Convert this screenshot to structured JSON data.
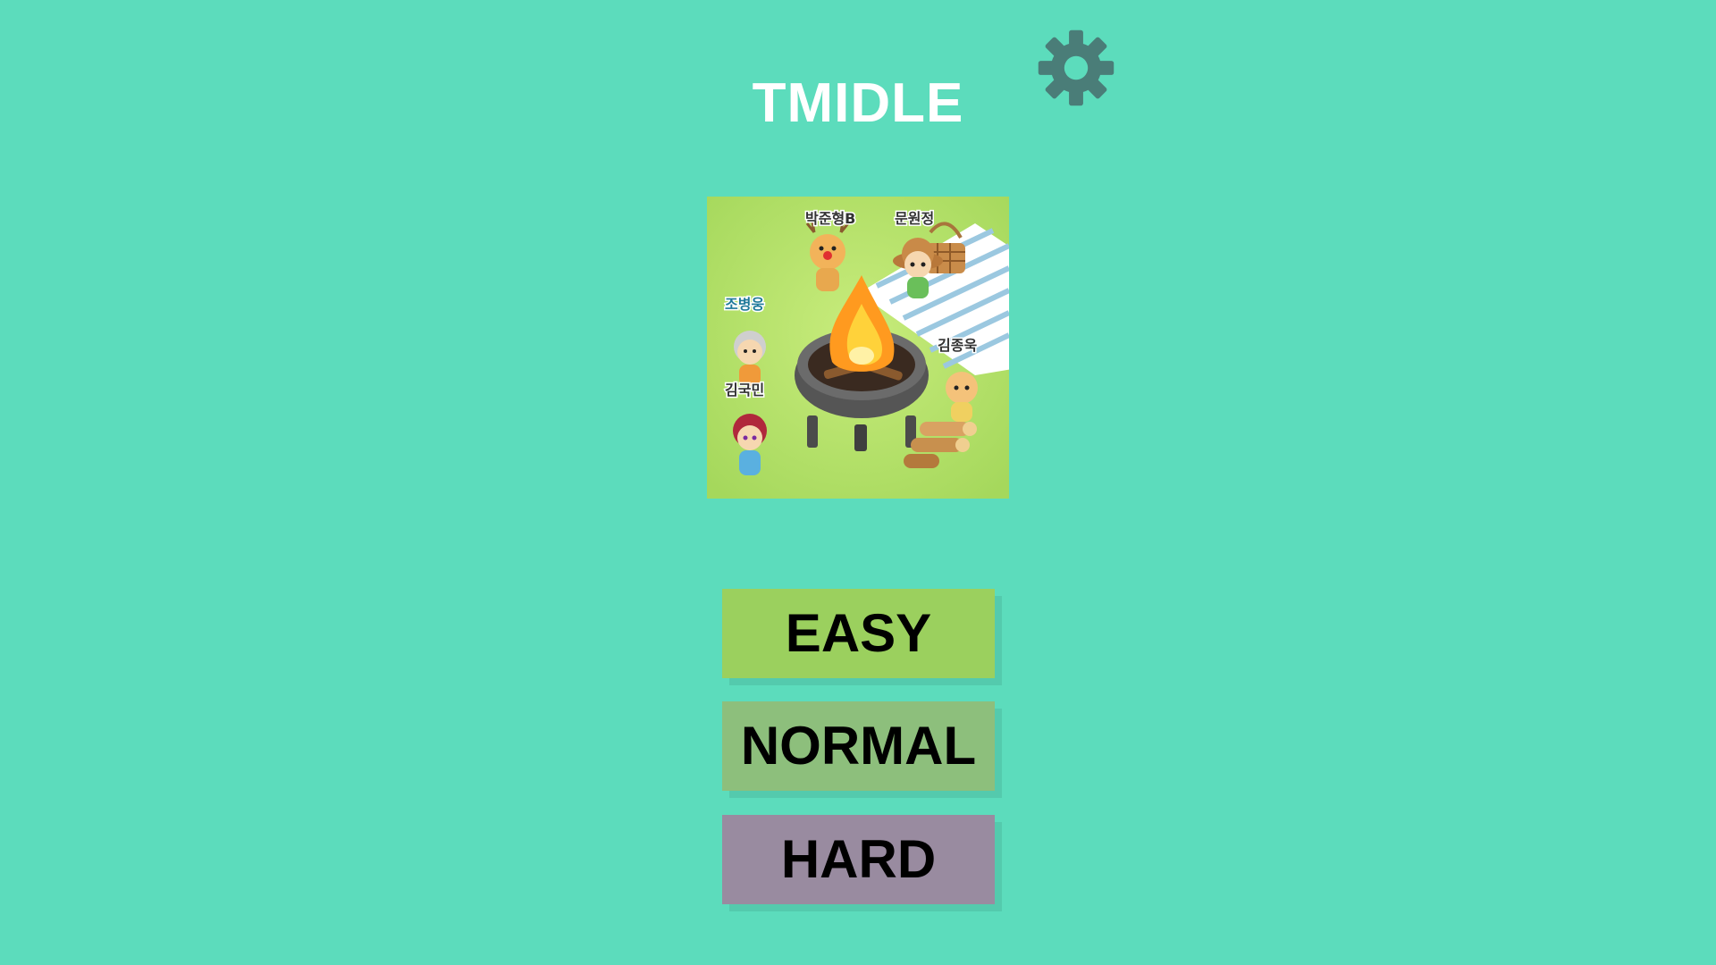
{
  "title": "TMIDLE",
  "settings": {
    "icon": "gear-icon",
    "color": "#4a7d78"
  },
  "background_color": "#5cdcbc",
  "artwork": {
    "description_icon": "campfire-picnic-scene",
    "character_names": [
      "박준형B",
      "문원정",
      "조병웅",
      "김종욱",
      "김국민"
    ]
  },
  "difficulty": {
    "easy": {
      "label": "EASY",
      "color": "#9bd05e"
    },
    "normal": {
      "label": "NORMAL",
      "color": "#8dbf7c"
    },
    "hard": {
      "label": "HARD",
      "color": "#998ba0"
    }
  }
}
